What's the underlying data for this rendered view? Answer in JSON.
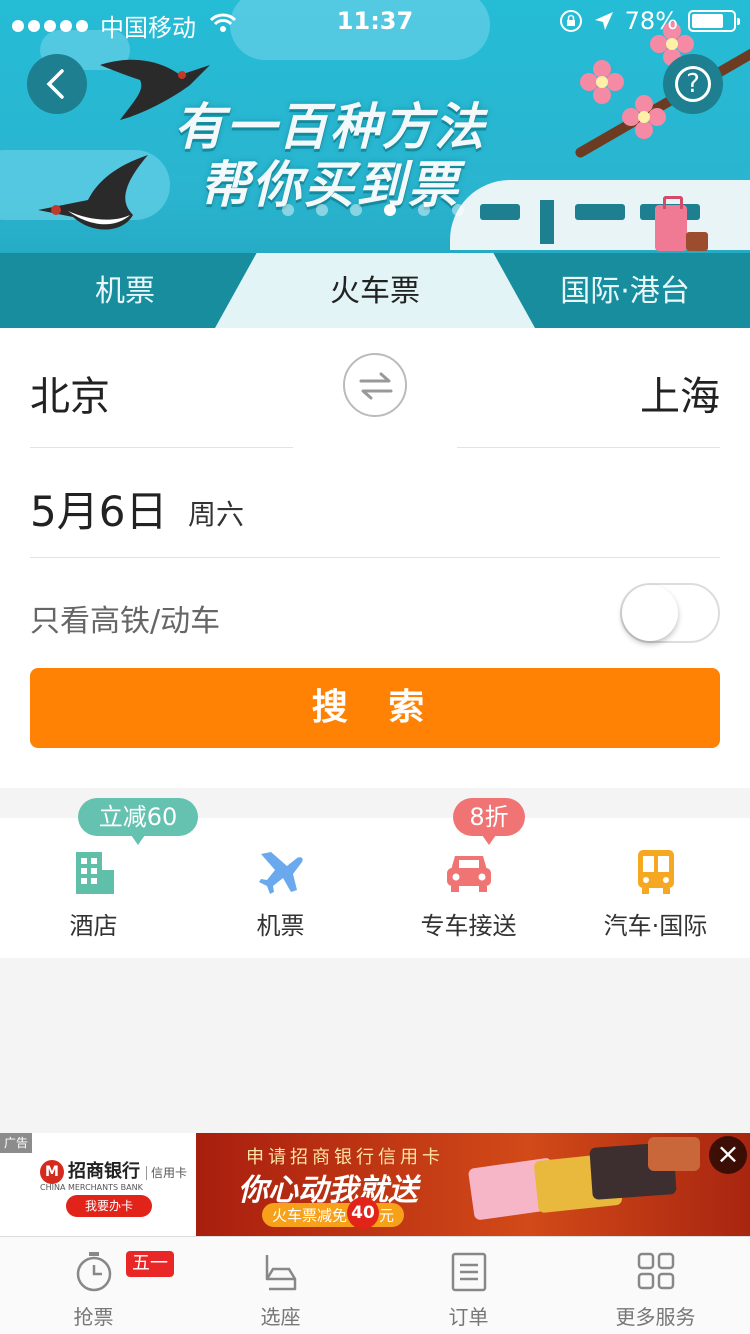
{
  "status_bar": {
    "carrier": "中国移动",
    "time": "11:37",
    "battery": "78%"
  },
  "banner": {
    "slogan_line1": "有一百种方法",
    "slogan_line2": "帮你买到票",
    "active_dot": 4,
    "dot_count": 6
  },
  "tabs": [
    {
      "label": "机票"
    },
    {
      "label": "火车票"
    },
    {
      "label": "国际·港台"
    }
  ],
  "form": {
    "from_city": "北京",
    "to_city": "上海",
    "date": "5月6日",
    "weekday": "周六",
    "filter_label": "只看高铁/动车",
    "filter_on": false,
    "search_label": "搜 索"
  },
  "services": [
    {
      "label": "酒店",
      "icon": "hotel-icon",
      "badge": "立减60"
    },
    {
      "label": "机票",
      "icon": "plane-icon",
      "badge": ""
    },
    {
      "label": "专车接送",
      "icon": "car-icon",
      "badge": "8折"
    },
    {
      "label": "汽车·国际",
      "icon": "bus-icon",
      "badge": ""
    }
  ],
  "ad": {
    "tag": "广告",
    "bank_name": "招商银行",
    "card_text": "信用卡",
    "bank_en": "CHINA MERCHANTS BANK",
    "apply_label": "我要办卡",
    "line1": "申请招商银行信用卡",
    "line2": "你心动我就送",
    "line3_prefix": "火车票减免",
    "line3_amount": "40",
    "line3_suffix": "元"
  },
  "tabbar": [
    {
      "label": "抢票",
      "icon": "stopwatch-icon",
      "badge": "五一"
    },
    {
      "label": "选座",
      "icon": "seat-icon"
    },
    {
      "label": "订单",
      "icon": "order-list-icon"
    },
    {
      "label": "更多服务",
      "icon": "grid-icon"
    }
  ],
  "colors": {
    "banner": "#25bcd6",
    "tab_bar": "#178d9e",
    "search_button": "#ff8205",
    "hotel": "#5fbfa8",
    "plane": "#6aa9ee",
    "car": "#f07474",
    "bus": "#f7a823"
  }
}
